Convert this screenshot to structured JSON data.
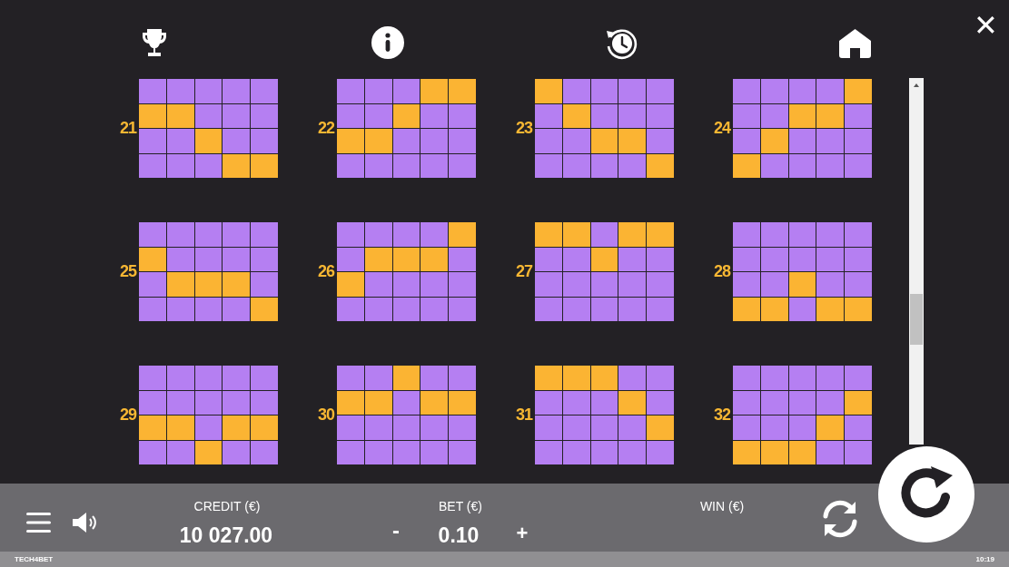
{
  "close_button": "✕",
  "paylines": [
    {
      "number": "21",
      "cells": [
        [
          false,
          false,
          false,
          false,
          false
        ],
        [
          true,
          true,
          false,
          false,
          false
        ],
        [
          false,
          false,
          true,
          false,
          false
        ],
        [
          false,
          false,
          false,
          true,
          true
        ]
      ]
    },
    {
      "number": "22",
      "cells": [
        [
          false,
          false,
          false,
          true,
          true
        ],
        [
          false,
          false,
          true,
          false,
          false
        ],
        [
          true,
          true,
          false,
          false,
          false
        ],
        [
          false,
          false,
          false,
          false,
          false
        ]
      ]
    },
    {
      "number": "23",
      "cells": [
        [
          true,
          false,
          false,
          false,
          false
        ],
        [
          false,
          true,
          false,
          false,
          false
        ],
        [
          false,
          false,
          true,
          true,
          false
        ],
        [
          false,
          false,
          false,
          false,
          true
        ]
      ]
    },
    {
      "number": "24",
      "cells": [
        [
          false,
          false,
          false,
          false,
          true
        ],
        [
          false,
          false,
          true,
          true,
          false
        ],
        [
          false,
          true,
          false,
          false,
          false
        ],
        [
          true,
          false,
          false,
          false,
          false
        ]
      ]
    },
    {
      "number": "25",
      "cells": [
        [
          false,
          false,
          false,
          false,
          false
        ],
        [
          true,
          false,
          false,
          false,
          false
        ],
        [
          false,
          true,
          true,
          true,
          false
        ],
        [
          false,
          false,
          false,
          false,
          true
        ]
      ]
    },
    {
      "number": "26",
      "cells": [
        [
          false,
          false,
          false,
          false,
          true
        ],
        [
          false,
          true,
          true,
          true,
          false
        ],
        [
          true,
          false,
          false,
          false,
          false
        ],
        [
          false,
          false,
          false,
          false,
          false
        ]
      ]
    },
    {
      "number": "27",
      "cells": [
        [
          true,
          true,
          false,
          true,
          true
        ],
        [
          false,
          false,
          true,
          false,
          false
        ],
        [
          false,
          false,
          false,
          false,
          false
        ],
        [
          false,
          false,
          false,
          false,
          false
        ]
      ]
    },
    {
      "number": "28",
      "cells": [
        [
          false,
          false,
          false,
          false,
          false
        ],
        [
          false,
          false,
          false,
          false,
          false
        ],
        [
          false,
          false,
          true,
          false,
          false
        ],
        [
          true,
          true,
          false,
          true,
          true
        ]
      ]
    },
    {
      "number": "29",
      "cells": [
        [
          false,
          false,
          false,
          false,
          false
        ],
        [
          false,
          false,
          false,
          false,
          false
        ],
        [
          true,
          true,
          false,
          true,
          true
        ],
        [
          false,
          false,
          true,
          false,
          false
        ]
      ]
    },
    {
      "number": "30",
      "cells": [
        [
          false,
          false,
          true,
          false,
          false
        ],
        [
          true,
          true,
          false,
          true,
          true
        ],
        [
          false,
          false,
          false,
          false,
          false
        ],
        [
          false,
          false,
          false,
          false,
          false
        ]
      ]
    },
    {
      "number": "31",
      "cells": [
        [
          true,
          true,
          true,
          false,
          false
        ],
        [
          false,
          false,
          false,
          true,
          false
        ],
        [
          false,
          false,
          false,
          false,
          true
        ],
        [
          false,
          false,
          false,
          false,
          false
        ]
      ]
    },
    {
      "number": "32",
      "cells": [
        [
          false,
          false,
          false,
          false,
          false
        ],
        [
          false,
          false,
          false,
          false,
          true
        ],
        [
          false,
          false,
          false,
          true,
          false
        ],
        [
          true,
          true,
          true,
          false,
          false
        ]
      ]
    }
  ],
  "bottom_bar": {
    "credit_label": "CREDIT (€)",
    "credit_value": "10 027.00",
    "bet_label": "BET (€)",
    "bet_minus": "-",
    "bet_value": "0.10",
    "bet_plus": "+",
    "win_label": "WIN (€)"
  },
  "footer": {
    "brand": "TECH4BET",
    "time": "10:19"
  }
}
